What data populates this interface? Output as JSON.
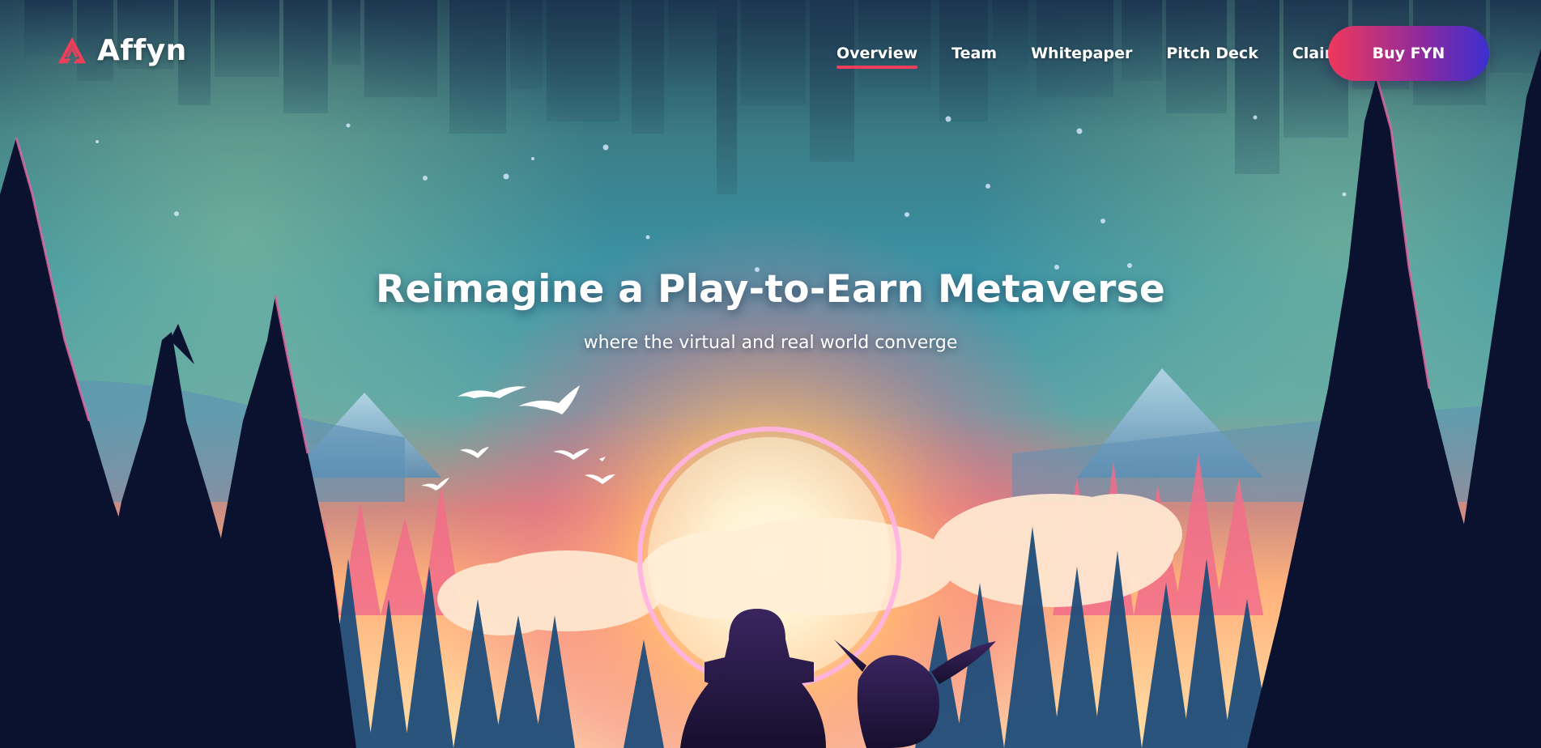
{
  "brand": {
    "name": "Affyn",
    "logo_icon": "affyn-logo-icon",
    "accent": "#ef3e5a"
  },
  "nav": {
    "items": [
      {
        "label": "Overview",
        "active": true
      },
      {
        "label": "Team",
        "active": false
      },
      {
        "label": "Whitepaper",
        "active": false
      },
      {
        "label": "Pitch Deck",
        "active": false
      },
      {
        "label": "Claim",
        "active": false
      }
    ],
    "cta_label": "Buy FYN",
    "cta_gradient": [
      "#f0385c",
      "#3b2fd0"
    ]
  },
  "hero": {
    "title": "Reimagine a Play-to-Earn Metaverse",
    "subtitle": "where the virtual and real world converge"
  },
  "colors": {
    "sky_top": "#2c5f73",
    "sky_mid": "#3f95a6",
    "sunset_glow": "#ff9a6a",
    "sun_ring": "#ff9ad0",
    "tree_dark": "#0b1230",
    "tree_blue": "#1f4d7a",
    "tree_pink": "#f26d8a"
  }
}
